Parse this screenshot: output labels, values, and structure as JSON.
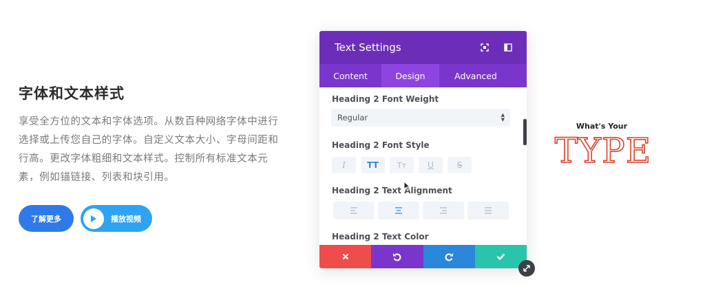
{
  "hero": {
    "title": "字体和文本样式",
    "description": "享受全方位的文本和字体选项。从数百种网络字体中进行选择或上传您自己的字体。自定义文本大小、字母间距和行高。更改字体粗细和文本样式。控制所有标准文本元素，例如锚链接、列表和块引用。",
    "learn_more": "了解更多",
    "play_video": "播放视频"
  },
  "panel": {
    "title": "Text Settings",
    "tabs": [
      "Content",
      "Design",
      "Advanced"
    ],
    "active_tab": "Design",
    "font_weight_label": "Heading 2 Font Weight",
    "font_weight_value": "Regular",
    "font_style_label": "Heading 2 Font Style",
    "font_style_buttons": [
      "I",
      "TT",
      "Tт",
      "U",
      "S"
    ],
    "alignment_label": "Heading 2 Text Alignment",
    "color_label": "Heading 2 Text Color",
    "colors": {
      "header": "#6c2eb9",
      "tabs": "#7a35cc",
      "active_tab": "#8e44e0",
      "discard": "#ef4c4c",
      "undo": "#7a35cc",
      "redo": "#2b87da",
      "save": "#29c4a9"
    }
  },
  "preview": {
    "subtitle": "What's Your",
    "headline": "TYPE"
  }
}
